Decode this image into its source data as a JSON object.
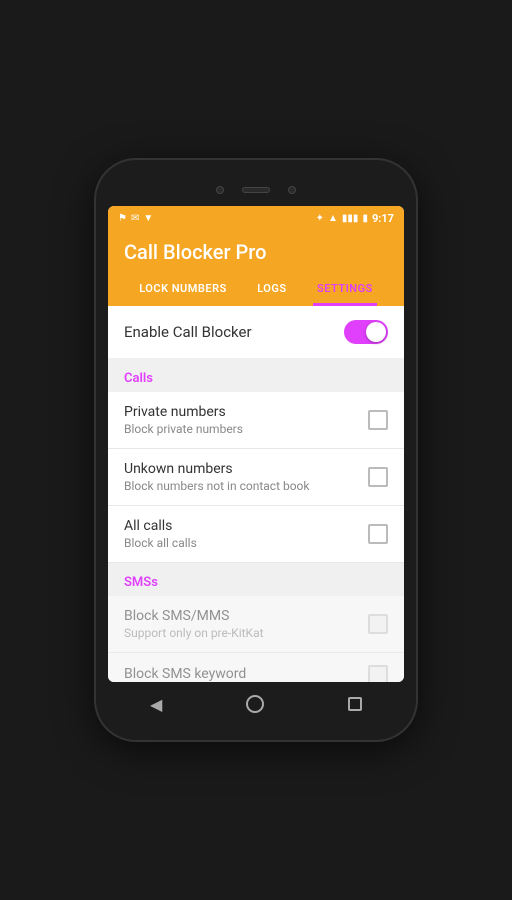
{
  "statusBar": {
    "time": "9:17",
    "leftIcons": [
      "notification-icon",
      "mail-icon",
      "pin-icon"
    ],
    "rightIcons": [
      "bluetooth-icon",
      "wifi-icon",
      "signal-icon",
      "battery-icon"
    ]
  },
  "header": {
    "title": "Call Blocker Pro"
  },
  "tabs": [
    {
      "id": "block-numbers",
      "label": "LOCK NUMBERS",
      "active": false
    },
    {
      "id": "logs",
      "label": "LOGS",
      "active": false
    },
    {
      "id": "settings",
      "label": "SETTINGS",
      "active": true
    }
  ],
  "enableCallBlocker": {
    "label": "Enable Call Blocker",
    "enabled": true
  },
  "sections": [
    {
      "id": "calls",
      "title": "Calls",
      "items": [
        {
          "id": "private-numbers",
          "title": "Private numbers",
          "subtitle": "Block private numbers",
          "checked": false,
          "disabled": false
        },
        {
          "id": "unknown-numbers",
          "title": "Unkown numbers",
          "subtitle": "Block numbers not in contact book",
          "checked": false,
          "disabled": false
        },
        {
          "id": "all-calls",
          "title": "All calls",
          "subtitle": "Block all calls",
          "checked": false,
          "disabled": false
        }
      ]
    },
    {
      "id": "smss",
      "title": "SMSs",
      "items": [
        {
          "id": "block-sms-mms",
          "title": "Block SMS/MMS",
          "subtitle": "Support only on pre-KitKat",
          "checked": false,
          "disabled": true
        },
        {
          "id": "block-sms-keyword",
          "title": "Block SMS keyword",
          "subtitle": "",
          "checked": false,
          "disabled": true
        }
      ]
    }
  ]
}
